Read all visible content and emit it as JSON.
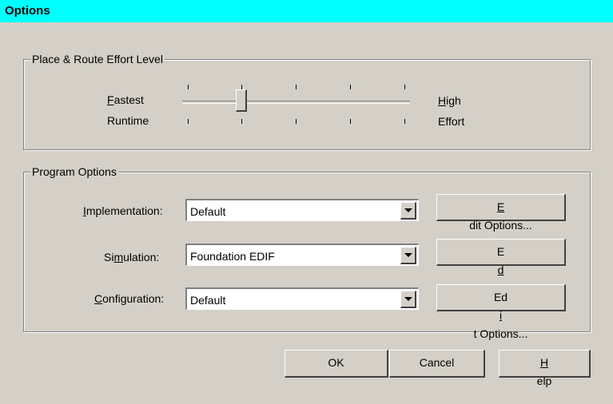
{
  "window": {
    "title": "Options"
  },
  "effort": {
    "group_label": "Place & Route Effort Level",
    "left_top": "Fastest",
    "left_bottom": "Runtime",
    "right_top": "High",
    "right_bottom": "Effort",
    "slider_position_index": 1,
    "tick_count": 5
  },
  "program": {
    "group_label": "Program Options",
    "rows": [
      {
        "label": "Implementation:",
        "value": "Default",
        "button": "Edit Options..."
      },
      {
        "label": "Simulation:",
        "value": "Foundation EDIF",
        "button": "Edit Options..."
      },
      {
        "label": "Configuration:",
        "value": "Default",
        "button": "Edit Options..."
      }
    ]
  },
  "buttons": {
    "ok": "OK",
    "cancel": "Cancel",
    "help": "Help"
  }
}
